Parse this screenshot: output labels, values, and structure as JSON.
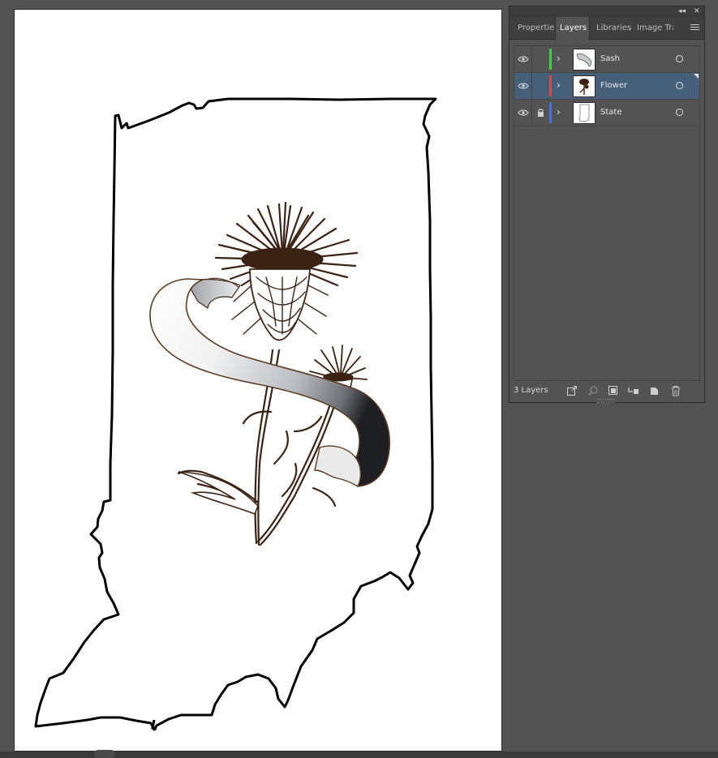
{
  "panel": {
    "tabs": [
      {
        "label": "Propertie"
      },
      {
        "label": "Layers"
      },
      {
        "label": "Libraries"
      },
      {
        "label": "Image Tra"
      }
    ],
    "active_tab": "Layers",
    "layers": [
      {
        "name": "Sash",
        "color": "#3ed13e",
        "locked": false,
        "visible": true,
        "selected": false
      },
      {
        "name": "Flower",
        "color": "#e04646",
        "locked": false,
        "visible": true,
        "selected": true
      },
      {
        "name": "State",
        "color": "#4a6fe0",
        "locked": true,
        "visible": true,
        "selected": false
      }
    ],
    "footer": {
      "layer_count": "3 Layers"
    },
    "icons": {
      "collapse": "double-chevron-left-icon",
      "close": "close-icon",
      "menu": "hamburger-menu-icon",
      "visibility": "eye-icon",
      "lock": "lock-icon",
      "expand": "chevron-right-icon",
      "target": "target-circle-icon",
      "footer": [
        "export-icon",
        "search-icon",
        "clip-mask-icon",
        "sublayer-icon",
        "new-layer-icon",
        "trash-icon"
      ]
    }
  },
  "colors": {
    "workspace_bg": "#535353",
    "selection": "#46607a",
    "artwork_stroke": "#000000",
    "thistle_brown": "#3b2212"
  }
}
